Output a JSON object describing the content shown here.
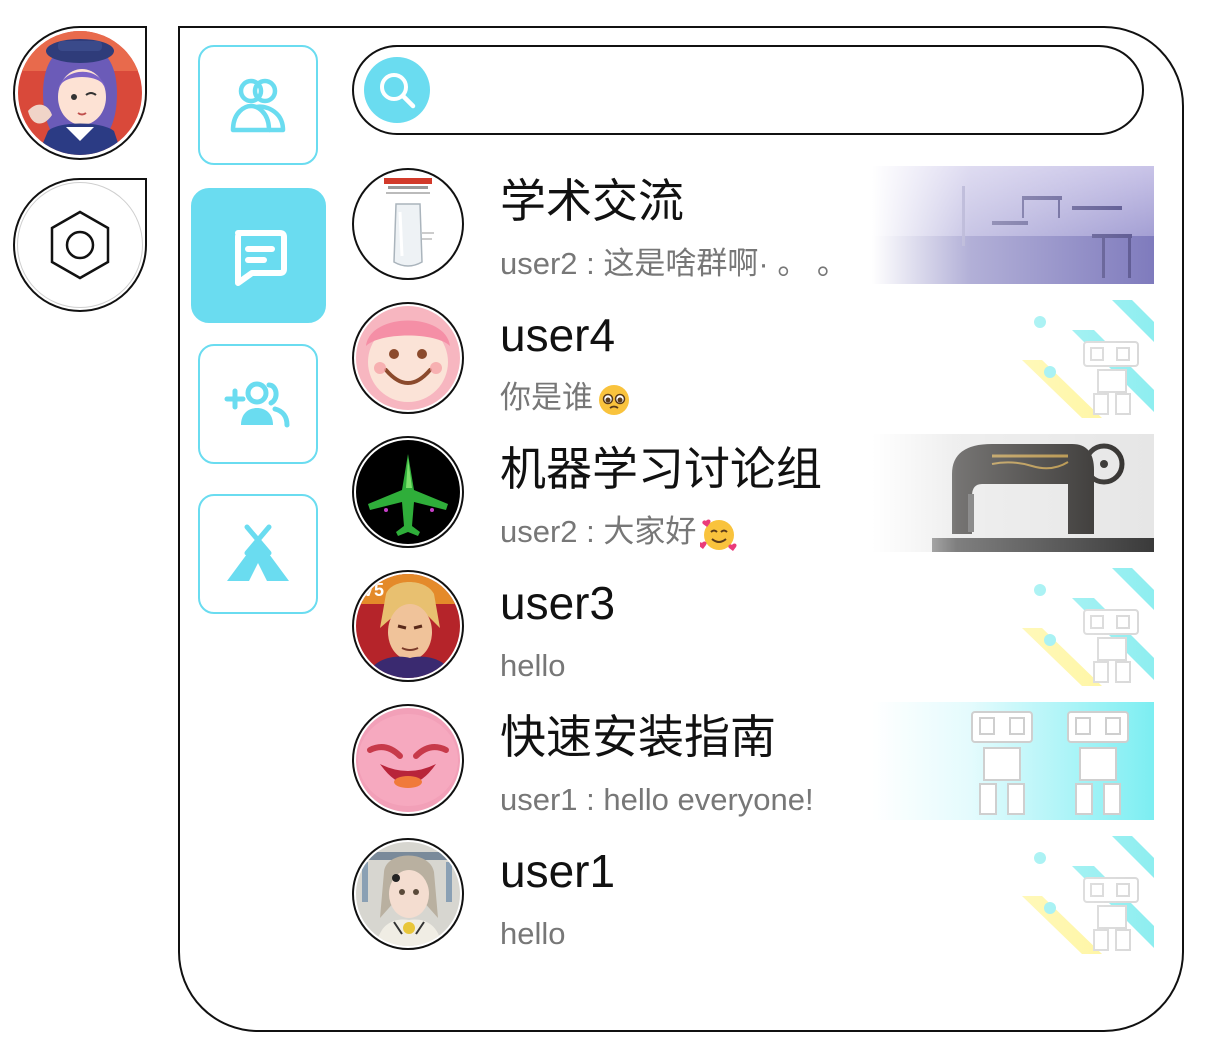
{
  "dock": {
    "icons": {
      "avatar": "user-avatar",
      "settings": "hexagon-settings-icon"
    }
  },
  "nav": {
    "items": [
      {
        "id": "friends",
        "icon": "users-icon",
        "active": false
      },
      {
        "id": "chats",
        "icon": "chat-bubble-icon",
        "active": true
      },
      {
        "id": "add-friend",
        "icon": "add-user-icon",
        "active": false
      },
      {
        "id": "plaza",
        "icon": "tent-icon",
        "active": false
      }
    ]
  },
  "search": {
    "value": "",
    "placeholder": ""
  },
  "chats": [
    {
      "name": "学术交流",
      "last_message": "user2 : 这是啥群啊· 。 。",
      "emoji": "",
      "background": "scenery-photo"
    },
    {
      "name": "user4",
      "last_message": "你是谁",
      "emoji": "pleading-face",
      "background": "robot-pattern"
    },
    {
      "name": "机器学习讨论组",
      "last_message": "user2 : 大家好",
      "emoji": "smiling-face-with-hearts",
      "background": "sewing-machine-photo"
    },
    {
      "name": "user3",
      "last_message": "hello",
      "emoji": "",
      "background": "robot-pattern"
    },
    {
      "name": "快速安装指南",
      "last_message": "user1 : hello everyone!",
      "emoji": "",
      "background": "robot-banner"
    },
    {
      "name": "user1",
      "last_message": "hello",
      "emoji": "",
      "background": "robot-pattern"
    }
  ],
  "colors": {
    "accent": "#6adcf0",
    "border": "#111111",
    "name_text": "#111111",
    "message_text": "#777777"
  }
}
